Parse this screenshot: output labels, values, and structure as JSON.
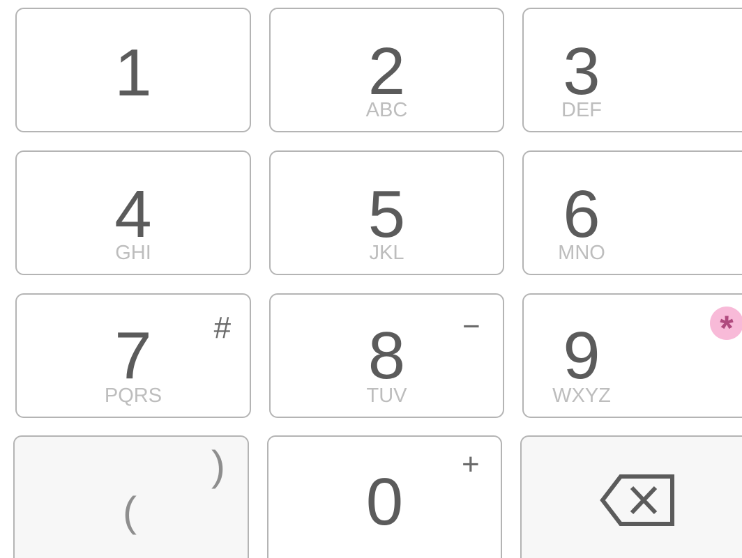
{
  "keypad": {
    "keys": [
      {
        "digit": "1",
        "letters": "",
        "secondary": ""
      },
      {
        "digit": "2",
        "letters": "ABC",
        "secondary": ""
      },
      {
        "digit": "3",
        "letters": "DEF",
        "secondary": ""
      },
      {
        "digit": "4",
        "letters": "GHI",
        "secondary": ""
      },
      {
        "digit": "5",
        "letters": "JKL",
        "secondary": ""
      },
      {
        "digit": "6",
        "letters": "MNO",
        "secondary": ""
      },
      {
        "digit": "7",
        "letters": "PQRS",
        "secondary": "#"
      },
      {
        "digit": "8",
        "letters": "TUV",
        "secondary": "−"
      },
      {
        "digit": "9",
        "letters": "WXYZ",
        "secondary": "*"
      },
      {
        "digit": "0",
        "letters": "",
        "secondary": "+"
      }
    ],
    "paren_key": {
      "open": "(",
      "close": ")"
    },
    "backspace_icon": "backspace-icon"
  },
  "colors": {
    "digit": "#5b5b5b",
    "letters": "#bdbdbd",
    "border": "#b4b4b4",
    "star_badge_bg": "#f8bad8",
    "star_badge_fg": "#b04a7e",
    "function_key_bg": "#f7f7f7"
  }
}
